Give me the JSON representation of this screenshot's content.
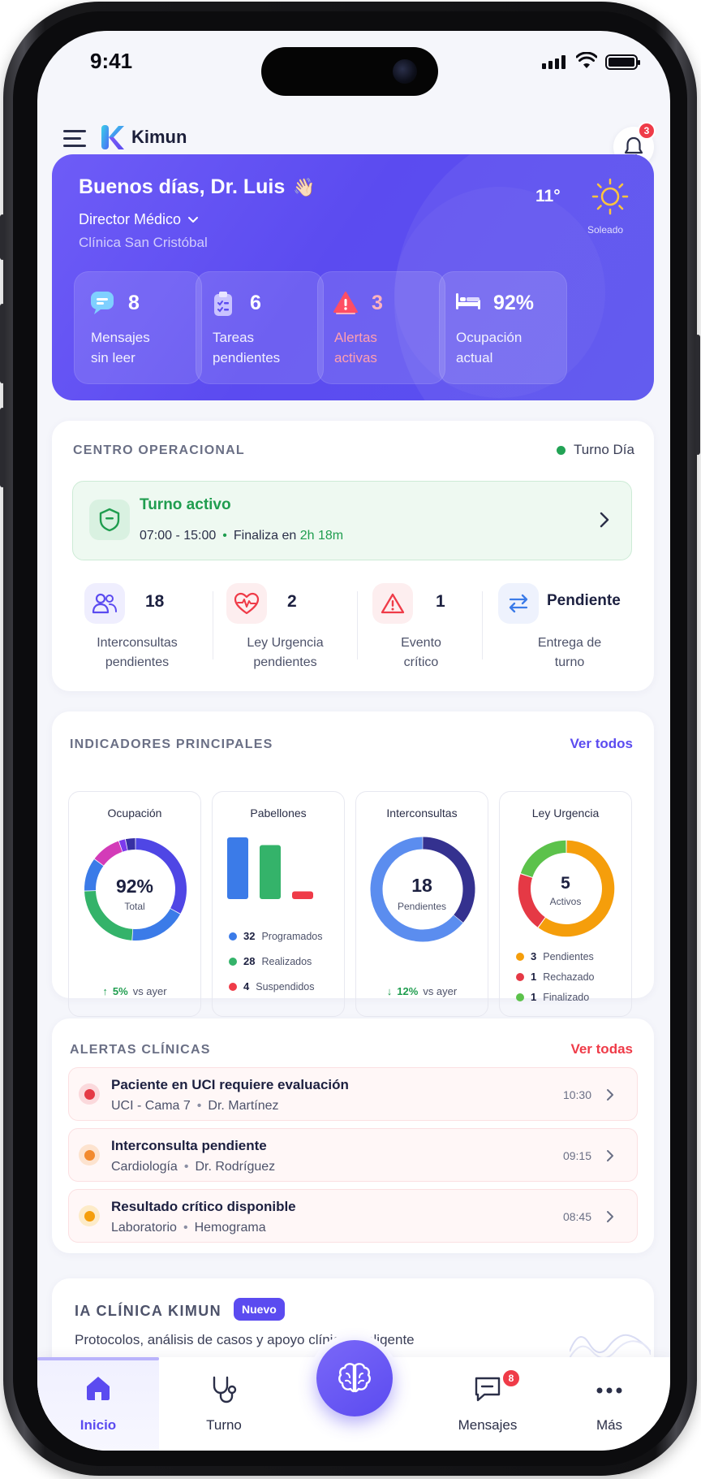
{
  "status_bar": {
    "time": "9:41"
  },
  "header": {
    "app_name": "Kimun",
    "notifications_count": "3"
  },
  "hero": {
    "greeting": "Buenos días, Dr. Luis",
    "greeting_emoji": "👋🏻",
    "role": "Director Médico",
    "clinic": "Clínica San Cristóbal",
    "weather": {
      "temperature": "11°",
      "condition": "Soleado",
      "icon": "sun-icon"
    },
    "stats": [
      {
        "value": "8",
        "label_line1": "Mensajes",
        "label_line2": "sin leer",
        "icon": "chat-icon"
      },
      {
        "value": "6",
        "label_line1": "Tareas",
        "label_line2": "pendientes",
        "icon": "clipboard-icon"
      },
      {
        "value": "3",
        "label_line1": "Alertas",
        "label_line2": "activas",
        "icon": "alert-icon"
      },
      {
        "value": "92%",
        "label_line1": "Ocupación",
        "label_line2": "actual",
        "icon": "bed-icon"
      }
    ]
  },
  "operations": {
    "title": "CENTRO OPERACIONAL",
    "shift_label": "Turno Día",
    "active_shift": {
      "title": "Turno activo",
      "hours": "07:00 - 15:00",
      "ends_prefix": "Finaliza en",
      "ends_in": "2h 18m"
    },
    "items": [
      {
        "value": "18",
        "label_line1": "Interconsultas",
        "label_line2": "pendientes",
        "icon": "users-icon"
      },
      {
        "value": "2",
        "label_line1": "Ley Urgencia",
        "label_line2": "pendientes",
        "icon": "heart-pulse-icon"
      },
      {
        "value": "1",
        "label_line1": "Evento",
        "label_line2": "crítico",
        "icon": "warning-icon"
      },
      {
        "value": "Pendiente",
        "label_line1": "Entrega de",
        "label_line2": "turno",
        "icon": "swap-icon"
      }
    ]
  },
  "indicators": {
    "title": "INDICADORES PRINCIPALES",
    "see_all": "Ver todos",
    "occupancy": {
      "title": "Ocupación",
      "center_value": "92%",
      "center_label": "Total",
      "trend_value": "5%",
      "trend_label": "vs ayer"
    },
    "pavilions": {
      "title": "Pabellones",
      "legend": [
        {
          "value": "32",
          "label": "Programados",
          "color": "#3b7be8"
        },
        {
          "value": "28",
          "label": "Realizados",
          "color": "#34b36a"
        },
        {
          "value": "4",
          "label": "Suspendidos",
          "color": "#ef3b48"
        }
      ]
    },
    "interconsults": {
      "title": "Interconsultas",
      "center_value": "18",
      "center_label": "Pendientes",
      "trend_value": "12%",
      "trend_label": "vs ayer"
    },
    "urgency_law": {
      "title": "Ley Urgencia",
      "center_value": "5",
      "center_label": "Activos",
      "legend": [
        {
          "value": "3",
          "label": "Pendientes",
          "color": "#f59e0b"
        },
        {
          "value": "1",
          "label": "Rechazado",
          "color": "#e53945"
        },
        {
          "value": "1",
          "label": "Finalizado",
          "color": "#5cc24b"
        }
      ]
    }
  },
  "chart_data": [
    {
      "type": "pie",
      "title": "Ocupación",
      "labels": [],
      "values": [
        31,
        17,
        22,
        10,
        9,
        2,
        3
      ],
      "colors": [
        "#4f46e5",
        "#3b7be8",
        "#34b36a",
        "#3b7be8",
        "#d33bb8",
        "#7c3aed",
        "#3730a3"
      ]
    },
    {
      "type": "bar",
      "title": "Pabellones",
      "categories": [
        "Programados",
        "Realizados",
        "Suspendidos"
      ],
      "values": [
        32,
        28,
        4
      ],
      "colors": [
        "#3b7be8",
        "#34b36a",
        "#ef3b48"
      ]
    },
    {
      "type": "pie",
      "title": "Interconsultas",
      "labels": [],
      "values": [
        36,
        64
      ],
      "colors": [
        "#34318f",
        "#5b8def"
      ]
    },
    {
      "type": "pie",
      "title": "Ley Urgencia",
      "labels": [
        "Pendientes",
        "Rechazado",
        "Finalizado"
      ],
      "values": [
        3,
        1,
        1
      ],
      "colors": [
        "#f59e0b",
        "#e53945",
        "#5cc24b"
      ]
    }
  ],
  "alerts": {
    "title": "ALERTAS CLÍNICAS",
    "see_all": "Ver todas",
    "items": [
      {
        "title": "Paciente en UCI requiere evaluación",
        "location": "UCI - Cama 7",
        "doctor": "Dr. Martínez",
        "time": "10:30",
        "color": "#e53945"
      },
      {
        "title": "Interconsulta pendiente",
        "location": "Cardiología",
        "doctor": "Dr. Rodríguez",
        "time": "09:15",
        "color": "#f28a2f"
      },
      {
        "title": "Resultado crítico disponible",
        "location": "Laboratorio",
        "doctor": "Hemograma",
        "time": "08:45",
        "color": "#f59e0b"
      }
    ]
  },
  "ai": {
    "title": "IA CLÍNICA KIMUN",
    "badge": "Nuevo",
    "description": "Protocolos, análisis de casos y apoyo clínico inteligente"
  },
  "tabbar": {
    "tabs": [
      {
        "label": "Inicio",
        "icon": "home-icon"
      },
      {
        "label": "Turno",
        "icon": "stethoscope-icon"
      },
      {
        "label": "Mensajes",
        "icon": "message-icon",
        "badge": "8"
      },
      {
        "label": "Más",
        "icon": "more-icon"
      }
    ],
    "center_icon": "brain-icon"
  },
  "colors": {
    "primary": "#5b4bf0",
    "success": "#1f9d4f",
    "danger": "#ef3b48",
    "background": "#f5f6fb"
  }
}
